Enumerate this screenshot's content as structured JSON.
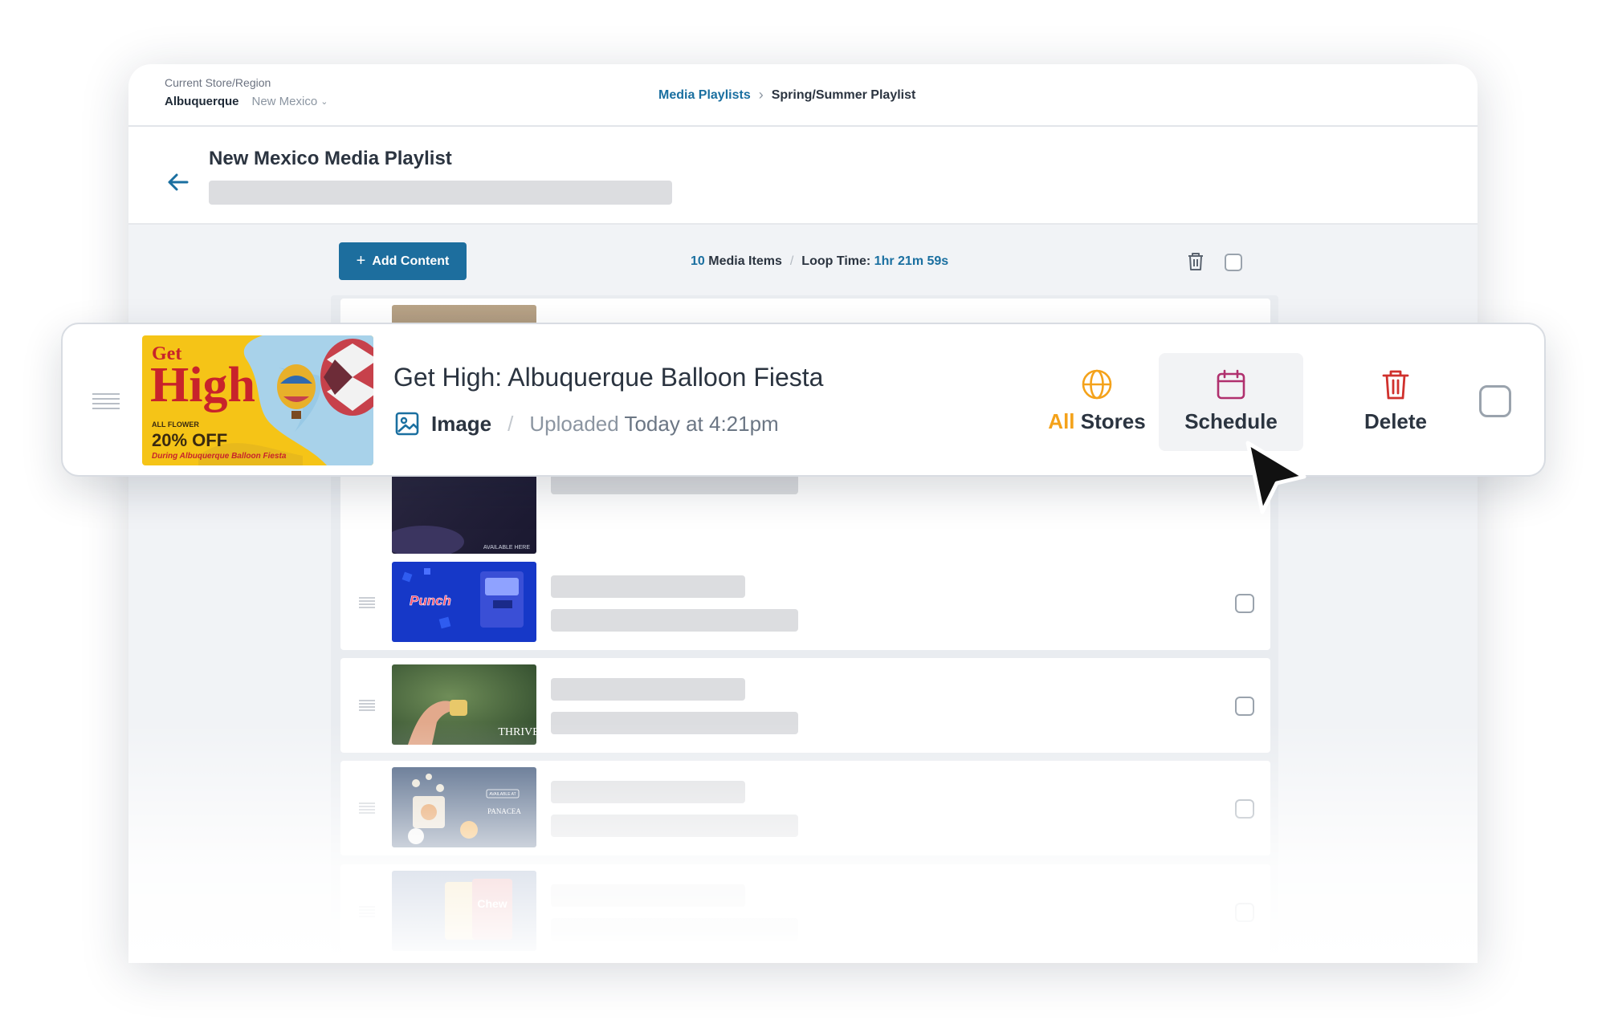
{
  "topbar": {
    "store_label": "Current Store/Region",
    "store_name": "Albuquerque",
    "region": "New Mexico"
  },
  "breadcrumb": {
    "parent": "Media Playlists",
    "current": "Spring/Summer Playlist"
  },
  "header": {
    "title": "New Mexico Media Playlist"
  },
  "toolbar": {
    "add_label": "Add Content",
    "media_count": "10",
    "media_label": "Media Items",
    "loop_label": "Loop Time:",
    "loop_value": "1hr 21m 59s"
  },
  "featured_item": {
    "title": "Get High: Albuquerque Balloon Fiesta",
    "type": "Image",
    "uploaded_label": "Uploaded",
    "uploaded_time": "Today at 4:21pm",
    "thumb": {
      "line1": "Get",
      "line2": "High",
      "line3": "ALL FLOWER",
      "line4": "20% OFF",
      "line5": "During Albuquerque Balloon Fiesta"
    },
    "actions": {
      "stores_prefix": "All",
      "stores_label": "Stores",
      "schedule_label": "Schedule",
      "delete_label": "Delete"
    }
  },
  "thumb_text": {
    "partial": "AVAILABLE HERE",
    "punch": "Punch",
    "thrive": "THRIVE",
    "panacea": "PANACEA",
    "panacea_tag": "AVAILABLE AT",
    "chew": "Chew"
  },
  "colors": {
    "primary": "#1d6e9e",
    "link": "#1a6fa0",
    "stores_accent": "#f4a21a",
    "schedule_icon": "#b0306e",
    "delete_icon": "#d0312d"
  },
  "icons": {
    "back": "arrow-left-icon",
    "trash": "trash-icon",
    "globe": "globe-icon",
    "calendar": "calendar-icon",
    "image": "image-icon",
    "drag": "drag-handle-icon",
    "cursor": "mouse-pointer-icon"
  }
}
